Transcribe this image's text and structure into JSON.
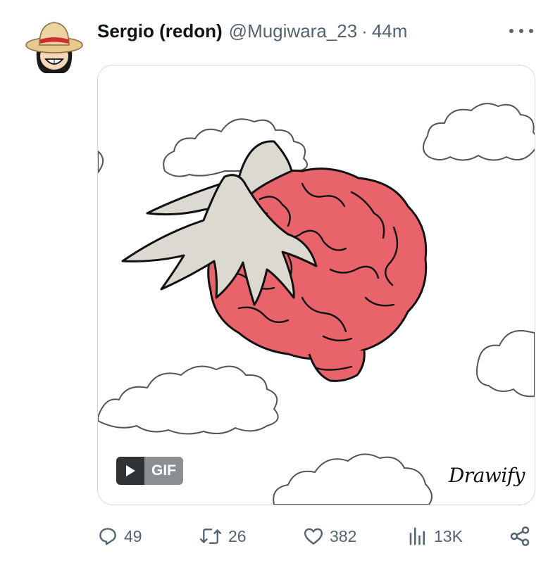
{
  "tweet": {
    "author": {
      "display_name": "Sergio (redon)",
      "handle": "@Mugiwara_23",
      "separator": "·",
      "time": "44m",
      "avatar_icon": "straw-hat-character-avatar"
    },
    "more_icon": "more-horizontal-icon",
    "media": {
      "type": "gif",
      "description_icon": "winged-brain-illustration",
      "gif_label": "GIF",
      "watermark": "Drawify"
    },
    "actions": {
      "replies": "49",
      "retweets": "26",
      "likes": "382",
      "views": "13K"
    }
  },
  "colors": {
    "text_primary": "#0f1419",
    "text_secondary": "#536471",
    "border": "#cfd9de",
    "brain": "#e8646a",
    "wing": "#dcd9d0",
    "watermark_accent": "#c1272d"
  }
}
